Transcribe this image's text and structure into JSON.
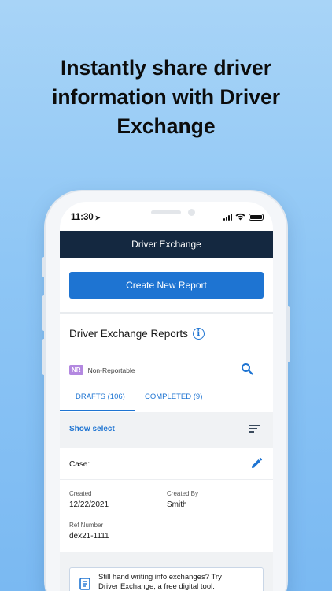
{
  "headline": {
    "line1": "Instantly share driver",
    "line2": "information with Driver",
    "line3": "Exchange"
  },
  "statusbar": {
    "time": "11:30"
  },
  "appbar": {
    "title": "Driver Exchange"
  },
  "create_button": {
    "label": "Create New Report"
  },
  "reports": {
    "title": "Driver Exchange Reports",
    "badge": "NR",
    "badge_text": "Non-Reportable"
  },
  "tabs": [
    {
      "label": "DRAFTS (106)"
    },
    {
      "label": "COMPLETED (9)"
    }
  ],
  "list": {
    "show_select": "Show select"
  },
  "card": {
    "case_label": "Case:",
    "created_label": "Created",
    "created_value": "12/22/2021",
    "created_by_label": "Created By",
    "created_by_value": "Smith",
    "ref_label": "Ref Number",
    "ref_value": "dex21-1111"
  },
  "promo": {
    "line1": "Still hand writing info exchanges? Try",
    "line2": "Driver Exchange, a free digital tool."
  },
  "colors": {
    "accent": "#1e74d2",
    "appbar": "#142840",
    "badge": "#b388e0"
  }
}
